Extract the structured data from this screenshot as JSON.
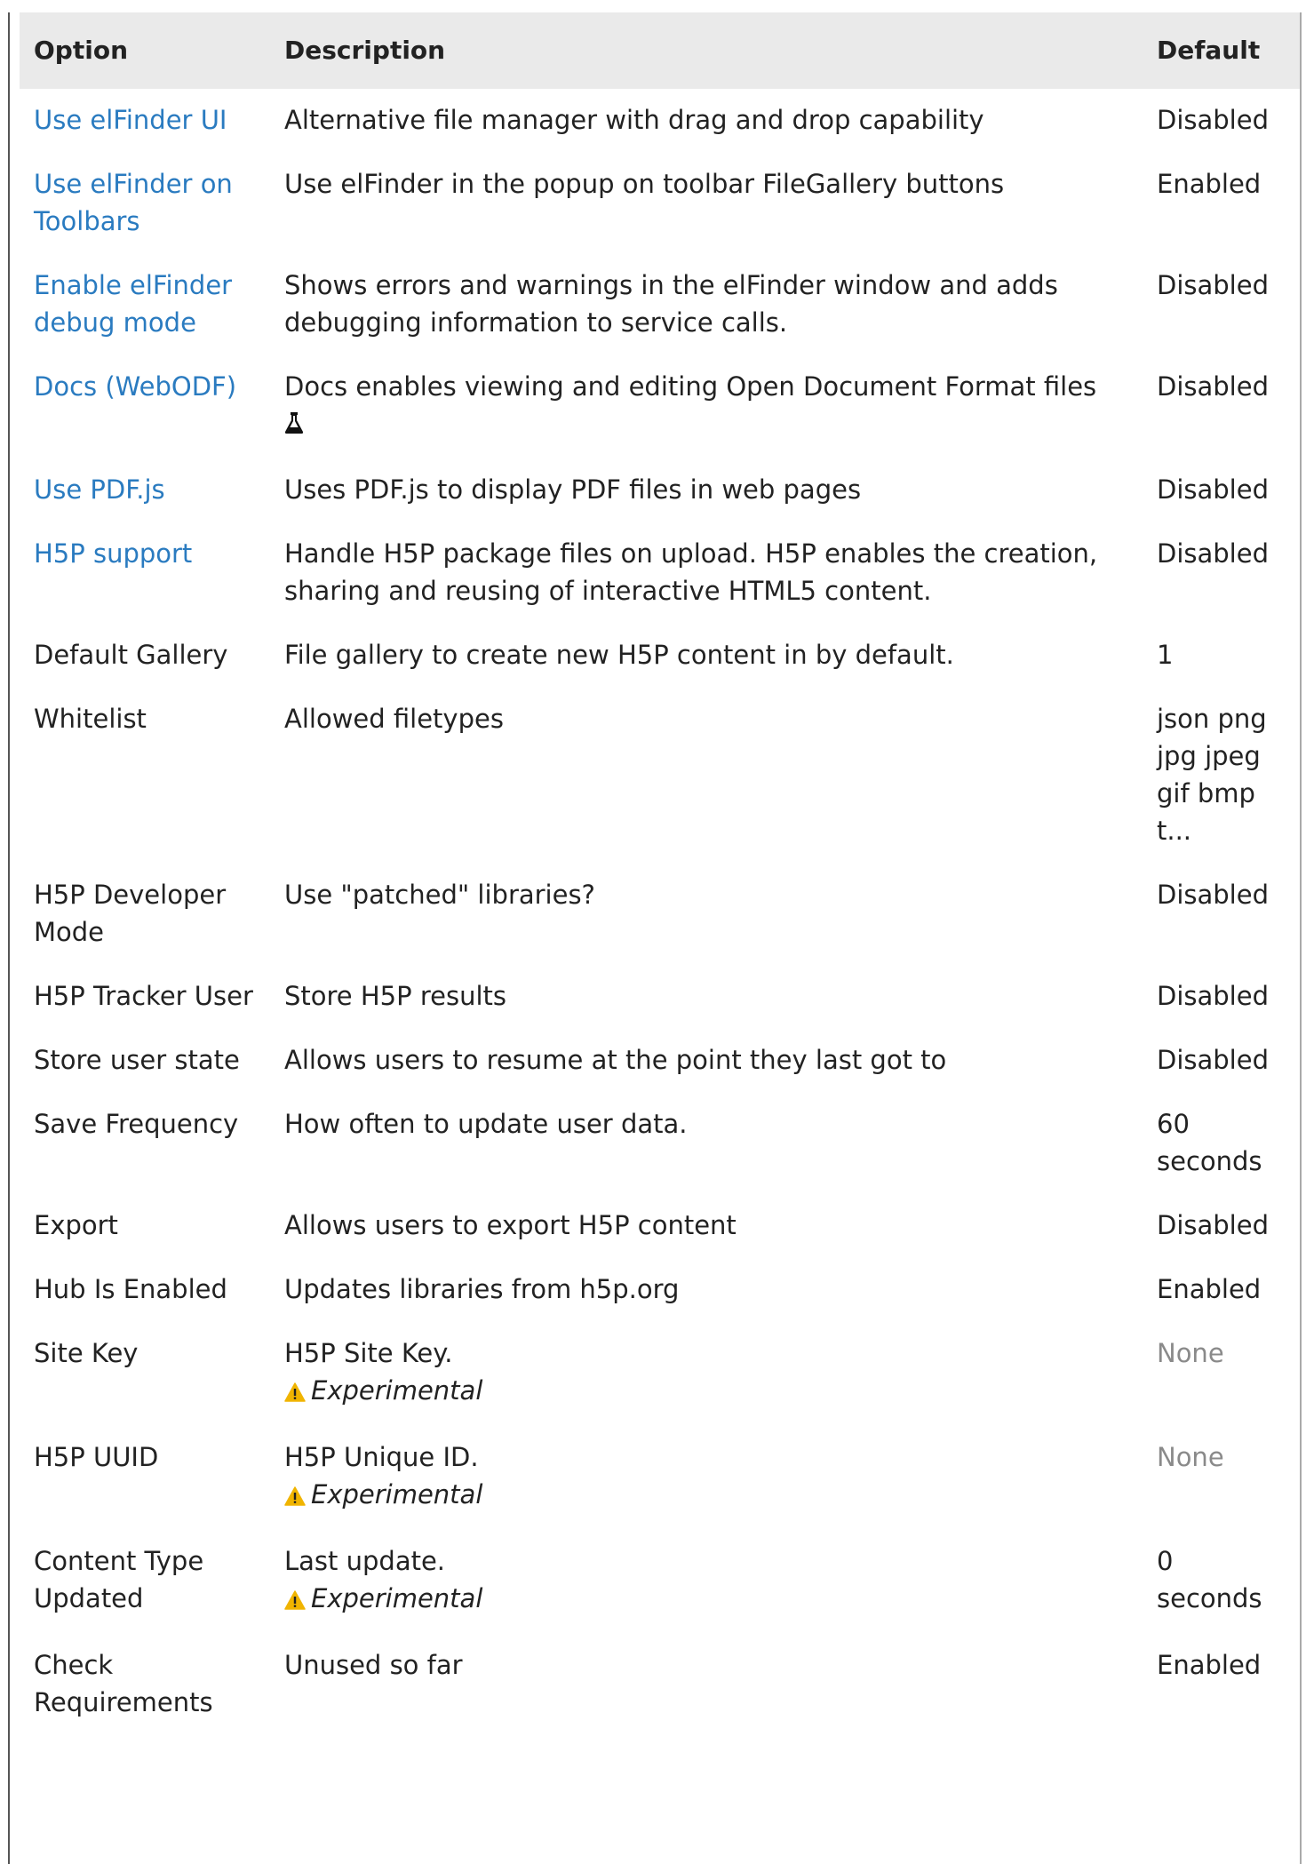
{
  "table": {
    "headers": {
      "option": "Option",
      "description": "Description",
      "default": "Default"
    },
    "rows": [
      {
        "option": "Use elFinder UI",
        "description": "Alternative file manager with drag and drop capability",
        "default": "Disabled"
      },
      {
        "option": "Use elFinder on Toolbars",
        "description": "Use elFinder in the popup on toolbar FileGallery buttons",
        "default": "Enabled"
      },
      {
        "option": "Enable elFinder debug mode",
        "description": "Shows errors and warnings in the elFinder window and adds debugging information to service calls.",
        "default": "Disabled"
      },
      {
        "option": "Docs (WebODF)",
        "description": "Docs enables viewing and editing Open Document Format files",
        "default": "Disabled"
      },
      {
        "option": "Use PDF.js",
        "description": "Uses PDF.js to display PDF files in web pages",
        "default": "Disabled"
      },
      {
        "option": "H5P support",
        "description": "Handle H5P package files on upload. H5P enables the creation, sharing and reusing of interactive HTML5 content.",
        "default": "Disabled"
      },
      {
        "option": "Default Gallery",
        "description": "File gallery to create new H5P content in by default.",
        "default": "1"
      },
      {
        "option": "Whitelist",
        "description": "Allowed filetypes",
        "default": "json png jpg jpeg gif bmp t..."
      },
      {
        "option": "H5P Developer Mode",
        "description": "Use \"patched\" libraries?",
        "default": "Disabled"
      },
      {
        "option": "H5P Tracker User",
        "description": "Store H5P results",
        "default": "Disabled"
      },
      {
        "option": "Store user state",
        "description": "Allows users to resume at the point they last got to",
        "default": "Disabled"
      },
      {
        "option": "Save Frequency",
        "description": "How often to update user data.",
        "default": "60 seconds"
      },
      {
        "option": "Export",
        "description": "Allows users to export H5P content",
        "default": "Disabled"
      },
      {
        "option": "Hub Is Enabled",
        "description": "Updates libraries from h5p.org",
        "default": "Enabled"
      },
      {
        "option": "Site Key",
        "description": "H5P Site Key.",
        "note": "Experimental",
        "default": "None"
      },
      {
        "option": "H5P UUID",
        "description": "H5P Unique ID.",
        "note": "Experimental",
        "default": "None"
      },
      {
        "option": "Content Type Updated",
        "description": "Last update.",
        "note": "Experimental",
        "default": "0 seconds"
      },
      {
        "option": "Check Requirements",
        "description": "Unused so far",
        "default": "Enabled"
      }
    ]
  },
  "colors": {
    "link": "#2a7bc0",
    "header_bg": "#eaeaea",
    "warning": "#f0b400",
    "muted": "#8a8a8a"
  },
  "icons": {
    "docs_row": "flask-icon",
    "experimental": "warning-icon"
  }
}
